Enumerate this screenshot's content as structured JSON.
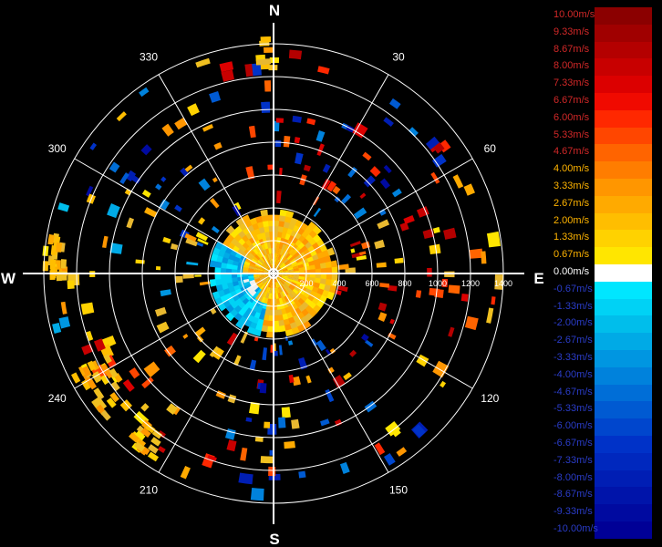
{
  "compass": {
    "north": "N",
    "east": "E",
    "south": "S",
    "west": "W"
  },
  "bearings": [
    {
      "label": "30",
      "deg": 30
    },
    {
      "label": "60",
      "deg": 60
    },
    {
      "label": "120",
      "deg": 120
    },
    {
      "label": "150",
      "deg": 150
    },
    {
      "label": "210",
      "deg": 210
    },
    {
      "label": "240",
      "deg": 240
    },
    {
      "label": "300",
      "deg": 300
    },
    {
      "label": "330",
      "deg": 330
    }
  ],
  "range_rings": [
    "200",
    "400",
    "600",
    "800",
    "1000",
    "1200",
    "1400"
  ],
  "legend": [
    {
      "label": "10.00m/s",
      "color": "#8b0000"
    },
    {
      "label": "9.33m/s",
      "color": "#a00000"
    },
    {
      "label": "8.67m/s",
      "color": "#b40000"
    },
    {
      "label": "8.00m/s",
      "color": "#c80000"
    },
    {
      "label": "7.33m/s",
      "color": "#dc0000"
    },
    {
      "label": "6.67m/s",
      "color": "#f00a00"
    },
    {
      "label": "6.00m/s",
      "color": "#ff2800"
    },
    {
      "label": "5.33m/s",
      "color": "#ff4600"
    },
    {
      "label": "4.67m/s",
      "color": "#ff6400"
    },
    {
      "label": "4.00m/s",
      "color": "#ff7d00"
    },
    {
      "label": "3.33m/s",
      "color": "#ff9600"
    },
    {
      "label": "2.67m/s",
      "color": "#ffaa00"
    },
    {
      "label": "2.00m/s",
      "color": "#ffbe00"
    },
    {
      "label": "1.33m/s",
      "color": "#ffd200"
    },
    {
      "label": "0.67m/s",
      "color": "#ffe600"
    },
    {
      "label": "0.00m/s",
      "color": "#ffffff"
    },
    {
      "label": "-0.67m/s",
      "color": "#00e6ff"
    },
    {
      "label": "-1.33m/s",
      "color": "#00d2f5"
    },
    {
      "label": "-2.00m/s",
      "color": "#00beeb"
    },
    {
      "label": "-2.67m/s",
      "color": "#00aae6"
    },
    {
      "label": "-3.33m/s",
      "color": "#0096e1"
    },
    {
      "label": "-4.00m/s",
      "color": "#0082dc"
    },
    {
      "label": "-4.67m/s",
      "color": "#006ed7"
    },
    {
      "label": "-5.33m/s",
      "color": "#005ad2"
    },
    {
      "label": "-6.00m/s",
      "color": "#0046cd"
    },
    {
      "label": "-6.67m/s",
      "color": "#0032c8"
    },
    {
      "label": "-7.33m/s",
      "color": "#0028be"
    },
    {
      "label": "-8.00m/s",
      "color": "#001eb4"
    },
    {
      "label": "-8.67m/s",
      "color": "#0014aa"
    },
    {
      "label": "-9.33m/s",
      "color": "#000aa0"
    },
    {
      "label": "-10.00m/s",
      "color": "#000096"
    }
  ],
  "legend_label_colors": {
    "positive": "#d22828",
    "mid_positive": "#ffb400",
    "zero": "#ffffff",
    "negative": "#2a3cc8"
  }
}
